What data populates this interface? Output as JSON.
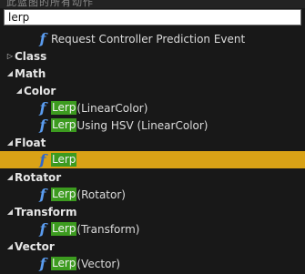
{
  "window": {
    "title": "此蓝图的所有动作"
  },
  "search": {
    "value": "lerp"
  },
  "tree": {
    "event_item": {
      "label": "Request Controller Prediction Event"
    },
    "categories": {
      "class": "Class",
      "math": "Math",
      "color": "Color",
      "float": "Float",
      "rotator": "Rotator",
      "transform": "Transform",
      "vector": "Vector"
    },
    "items": {
      "color_lerp": {
        "match": "Lerp",
        "rest": " (LinearColor)"
      },
      "color_lerp_hsv": {
        "match": "Lerp",
        "rest": " Using HSV (LinearColor)"
      },
      "float_lerp": {
        "match": "Lerp",
        "rest": ""
      },
      "rotator_lerp": {
        "match": "Lerp",
        "rest": " (Rotator)"
      },
      "transform_lerp": {
        "match": "Lerp",
        "rest": " (Transform)"
      },
      "vector_lerp": {
        "match": "Lerp",
        "rest": " (Vector)"
      }
    },
    "selected": "float_lerp"
  },
  "colors": {
    "background": "#181818",
    "selection": "#d9a216",
    "match_highlight": "#3c9b1f",
    "function_icon": "#5a9cf0"
  },
  "icons": {
    "function": "function-f-icon",
    "expanded": "triangle-down-icon",
    "collapsed": "triangle-right-icon"
  }
}
